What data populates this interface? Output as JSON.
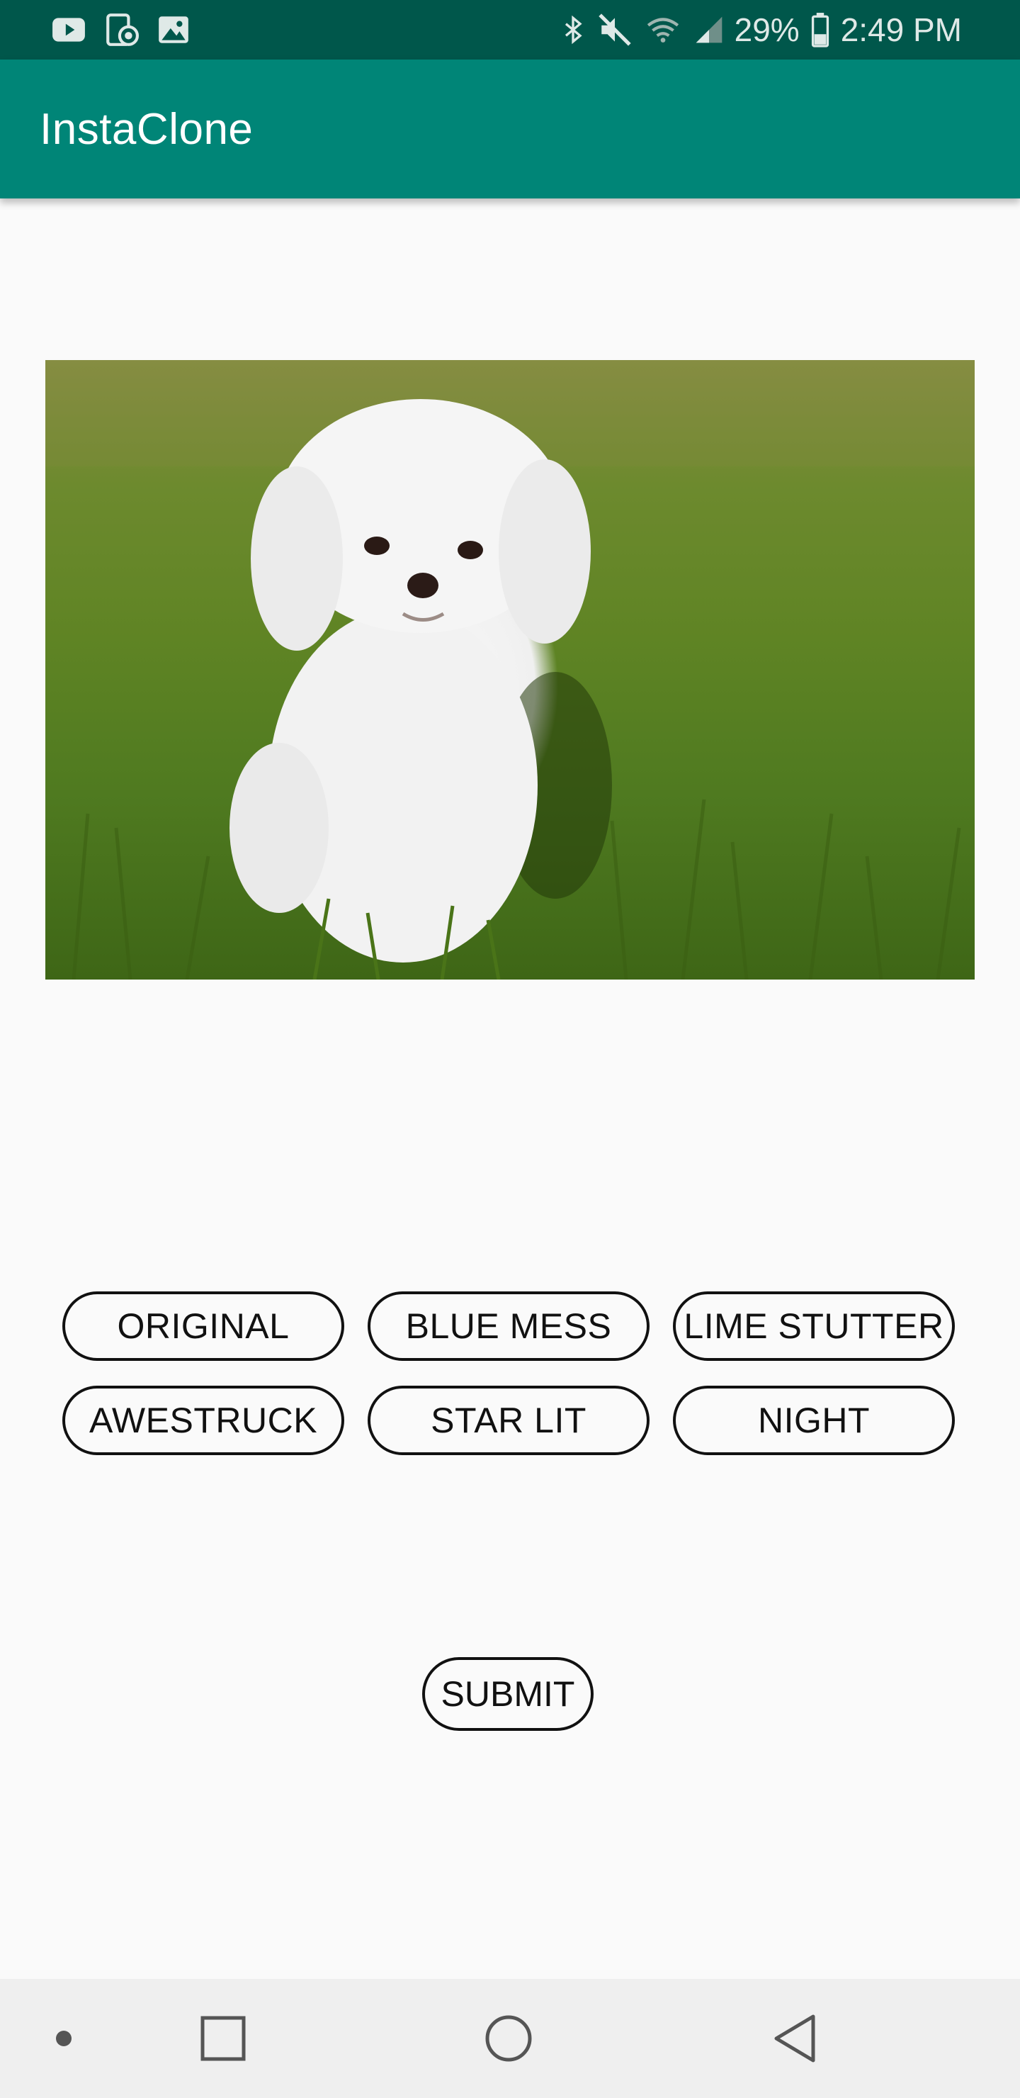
{
  "status_bar": {
    "left_icons": [
      "youtube-icon",
      "screen-record-icon",
      "gallery-icon"
    ],
    "right_icons": [
      "bluetooth-icon",
      "mute-icon",
      "wifi-icon",
      "signal-icon",
      "battery-icon"
    ],
    "battery_percent": "29%",
    "time": "2:49 PM"
  },
  "app_bar": {
    "title": "InstaClone"
  },
  "photo": {
    "subject": "dog-photo"
  },
  "filters": [
    {
      "label": "ORIGINAL"
    },
    {
      "label": "BLUE MESS"
    },
    {
      "label": "LIME STUTTER"
    },
    {
      "label": "AWESTRUCK"
    },
    {
      "label": "STAR LIT"
    },
    {
      "label": "NIGHT"
    }
  ],
  "submit": {
    "label": "SUBMIT"
  },
  "nav_bar": {
    "buttons": [
      "dot-icon",
      "recents-icon",
      "home-icon",
      "back-icon"
    ]
  },
  "colors": {
    "status_bar": "#00574b",
    "app_bar": "#008577",
    "background": "#fafafa"
  }
}
